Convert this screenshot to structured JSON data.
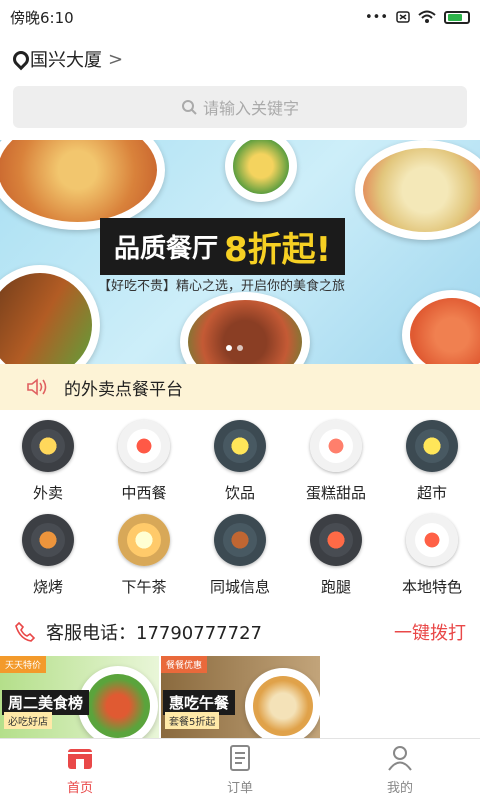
{
  "status_bar": {
    "time": "傍晚6:10",
    "dots": "•••"
  },
  "location": {
    "name": "国兴大厦",
    "chevron": ">"
  },
  "search": {
    "placeholder": "请输入关键字"
  },
  "banner": {
    "title": "品质餐厅",
    "title_big": "8折起!",
    "subtitle": "【好吃不贵】精心之选，开启你的美食之旅"
  },
  "notice": {
    "text": "的外卖点餐平台",
    "icon": "speaker-icon"
  },
  "categories": [
    {
      "label": "外卖",
      "color": "#3c3f44"
    },
    {
      "label": "中西餐",
      "color": "#f2f2f2"
    },
    {
      "label": "饮品",
      "color": "#3c4a52"
    },
    {
      "label": "蛋糕甜品",
      "color": "#f2f2f2"
    },
    {
      "label": "超市",
      "color": "#3c4a52"
    },
    {
      "label": "烧烤",
      "color": "#3c3f44"
    },
    {
      "label": "下午茶",
      "color": "#d8a858"
    },
    {
      "label": "同城信息",
      "color": "#3c4a52"
    },
    {
      "label": "跑腿",
      "color": "#3c3f44"
    },
    {
      "label": "本地特色",
      "color": "#f2f2f2"
    }
  ],
  "service": {
    "label": "客服电话：17790777727",
    "action": "一键拨打"
  },
  "promo_cards": [
    {
      "tag": "天天特价",
      "title": "周二美食榜",
      "sub": "必吃好店",
      "tag_color": "#f39a2b"
    },
    {
      "tag": "餐餐优惠",
      "title": "惠吃午餐",
      "sub": "套餐5折起",
      "tag_color": "#e9693b"
    }
  ],
  "tabs": [
    {
      "label": "首页",
      "icon": "shop-icon",
      "active": true
    },
    {
      "label": "订单",
      "icon": "order-icon",
      "active": false
    },
    {
      "label": "我的",
      "icon": "profile-icon",
      "active": false
    }
  ],
  "colors": {
    "accent": "#e94848",
    "notice_bg": "#fdf3d6",
    "search_bg": "#eeeeee"
  }
}
